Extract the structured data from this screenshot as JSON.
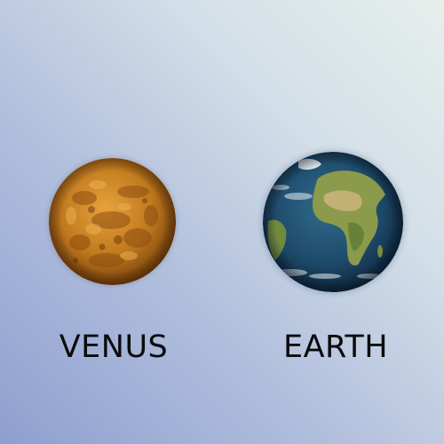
{
  "planets": [
    {
      "name": "VENUS",
      "icon": "venus-planet-image",
      "colors": {
        "surface": "#c17a1e",
        "highlight": "#e7a13c",
        "shadow": "#6e3a0a"
      }
    },
    {
      "name": "EARTH",
      "icon": "earth-planet-image",
      "colors": {
        "ocean": "#1e4a6a",
        "land": "#8c9a4c",
        "desert": "#c8b37a",
        "cloud": "#e8eef2"
      }
    }
  ],
  "background": {
    "from": "#8e9fcf",
    "to": "#e7efec"
  }
}
